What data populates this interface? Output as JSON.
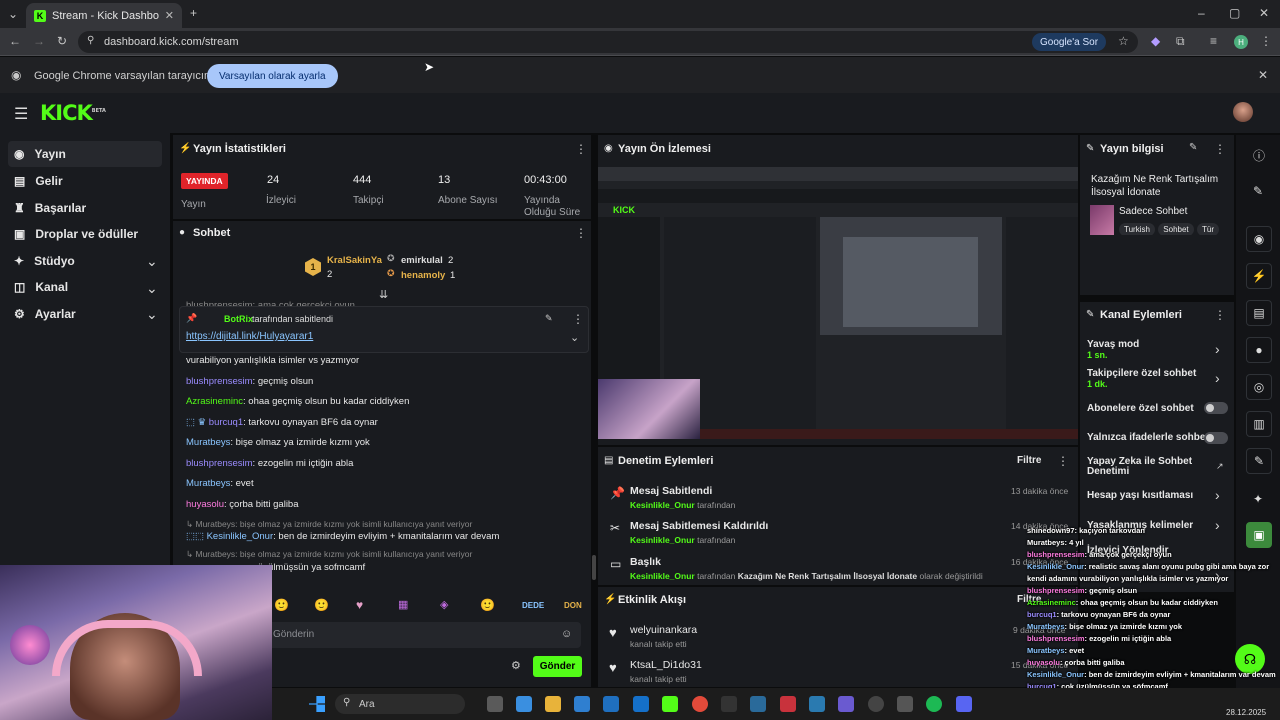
{
  "browser": {
    "tab_title": "Stream - Kick Dashboard",
    "url": "dashboard.kick.com/stream",
    "google_ask": "Google'a Sor",
    "infobar_text": "Google Chrome varsayılan tarayıcınız değil",
    "infobar_button": "Varsayılan olarak ayarla",
    "profile_initial": "H"
  },
  "app": {
    "logo": "KICK",
    "logo_badge": "BETA",
    "brand_color": "#53fc18"
  },
  "sidebar": {
    "items": [
      {
        "label": "Yayın",
        "icon": "broadcast-icon"
      },
      {
        "label": "Gelir",
        "icon": "revenue-icon"
      },
      {
        "label": "Başarılar",
        "icon": "trophy-icon"
      },
      {
        "label": "Droplar ve ödüller",
        "icon": "gift-icon"
      },
      {
        "label": "Stüdyo",
        "icon": "studio-icon"
      },
      {
        "label": "Kanal",
        "icon": "channel-icon"
      },
      {
        "label": "Ayarlar",
        "icon": "gear-icon"
      }
    ]
  },
  "stats": {
    "title": "Yayın İstatistikleri",
    "live_badge": "YAYINDA",
    "live_label": "Yayın",
    "viewers": "24",
    "viewers_label": "İzleyici",
    "followers": "444",
    "followers_label": "Takipçi",
    "subs": "13",
    "subs_label": "Abone Sayısı",
    "uptime": "00:43:00",
    "uptime_label": "Yayında Olduğu Süre"
  },
  "chat": {
    "title": "Sohbet",
    "leaders": [
      {
        "rank": "1",
        "name": "KralSakinYa",
        "count": "2"
      },
      {
        "name": "emirkulal",
        "count": "2"
      },
      {
        "name": "henamoly",
        "count": "1"
      }
    ],
    "partial_top": "blushprensesim: ama çok gerçekçi oyun",
    "pinned_user": "BotRix",
    "pinned_by": "tarafından sabitlendi",
    "pinned_link": "https://dijital.link/Hulyayarar1",
    "messages": [
      {
        "user": "",
        "text": "vurabiliyon yanlışlıkla isimler vs yazmıyor"
      },
      {
        "user": "blushprensesim",
        "text": ": geçmiş olsun"
      },
      {
        "user": "Azrasineminc",
        "text": ": ohaa geçmiş olsun bu kadar ciddiyken"
      },
      {
        "user": "burcuq1",
        "text": ": tarkovu oynayan BF6 da oynar"
      },
      {
        "user": "Muratbeys",
        "text": ": bişe olmaz ya izmirde kızmı yok"
      },
      {
        "user": "blushprensesim",
        "text": ": ezogelin mi içtiğin abla"
      },
      {
        "user": "Muratbeys",
        "text": ": evet"
      },
      {
        "user": "huyasolu",
        "text": ": çorba bitti galiba"
      }
    ],
    "reply1": "Muratbeys: bişe olmaz ya izmirde kızmı yok isimli kullanıcıya yanıt veriyor",
    "reply1_user": "Kesinlikle_Onur",
    "reply1_text": ": ben de izmirdeyim evliyim + kmanitalarım var devam",
    "reply2": "Muratbeys: bişe olmaz ya izmirde kızmı yok isimli kullanıcıya yanıt veriyor",
    "reply2_text": "üzülmüşsün ya sofmcamf",
    "emotes": [
      "DEDE",
      "DON"
    ],
    "input_placeholder": "Gönderin",
    "send_button": "Gönder"
  },
  "preview": {
    "title": "Yayın Ön İzlemesi"
  },
  "mod_actions": {
    "title": "Denetim Eylemleri",
    "filter": "Filtre",
    "items": [
      {
        "title": "Mesaj Sabitlendi",
        "user": "Kesinlikle_Onur",
        "suffix": "tarafından",
        "time": "13 dakika önce"
      },
      {
        "title": "Mesaj Sabitlemesi Kaldırıldı",
        "user": "Kesinlikle_Onur",
        "suffix": "tarafından",
        "time": "14 dakika önce"
      },
      {
        "title": "Başlık",
        "user": "Kesinlikle_Onur",
        "suffix": "tarafından",
        "detail": "Kazağım Ne Renk Tartışalım İlsosyal İdonate",
        "detail_suffix": "olarak değiştirildi",
        "time": "16 dakika önce"
      }
    ]
  },
  "activity": {
    "title": "Etkinlik Akışı",
    "filter": "Filtre",
    "items": [
      {
        "user": "welyuinankara",
        "action": "kanalı takip etti",
        "time": "9 dakika önce"
      },
      {
        "user": "KtsaL_Di1do31",
        "action": "kanalı takip etti",
        "time": "15 dakika önce"
      }
    ]
  },
  "stream_info": {
    "title": "Yayın bilgisi",
    "stream_title": "Kazağım Ne Renk Tartışalım İlsosyal İdonate",
    "category": "Sadece Sohbet",
    "tags": [
      "Turkish",
      "Sohbet",
      "Tür"
    ]
  },
  "channel_actions": {
    "title": "Kanal Eylemleri",
    "slow_mode": "Yavaş mod",
    "slow_value": "1 sn.",
    "followers_only": "Takipçilere özel sohbet",
    "followers_value": "1 dk.",
    "subs_only": "Abonelere özel sohbet",
    "emotes_only": "Yalnızca ifadelerle sohbet",
    "ai_mod": "Yapay Zeka ile Sohbet Denetimi",
    "age_restrict": "Hesap yaşı kısıtlaması",
    "banned_words": "Yasaklanmış kelimeler",
    "viewer_redirect": "İzleyici Yönlendir"
  },
  "overlay_chat": [
    {
      "user": "shinedown97",
      "text": ": kaçıyon tarkovdan"
    },
    {
      "user": "Muratbeys",
      "text": ": 4 yıl"
    },
    {
      "user": "blushprensesim",
      "text": ": ama çok gerçekçi oyun"
    },
    {
      "user": "Kesinlikle_Onur",
      "text": ": realistic savaş alanı oyunu pubg gibi ama baya zor"
    },
    {
      "user": "",
      "text": "kendi adamını vurabiliyon yanlışlıkla isimler vs yazmıyor"
    },
    {
      "user": "blushprensesim",
      "text": ": geçmiş olsun"
    },
    {
      "user": "Azrasineminc",
      "text": ": ohaa geçmiş olsun bu kadar ciddiyken"
    },
    {
      "user": "burcuq1",
      "text": ": tarkovu oynayan BF6 da oynar"
    },
    {
      "user": "Muratbeys",
      "text": ": bişe olmaz ya izmirde kızmı yok"
    },
    {
      "user": "blushprensesim",
      "text": ": ezogelin mi içtiğin abla"
    },
    {
      "user": "Muratbeys",
      "text": ": evet"
    },
    {
      "user": "huyasolu",
      "text": ": çorba bitti galiba"
    },
    {
      "user": "Kesinlikle_Onur",
      "text": ": ben de izmirdeyim evliyim + kmanitalarım var devam"
    },
    {
      "user": "burcuq1",
      "text": ": çok üzülmüşsün ya söfmçamf"
    }
  ],
  "taskbar": {
    "search": "Ara",
    "date": "28.12.2025"
  }
}
